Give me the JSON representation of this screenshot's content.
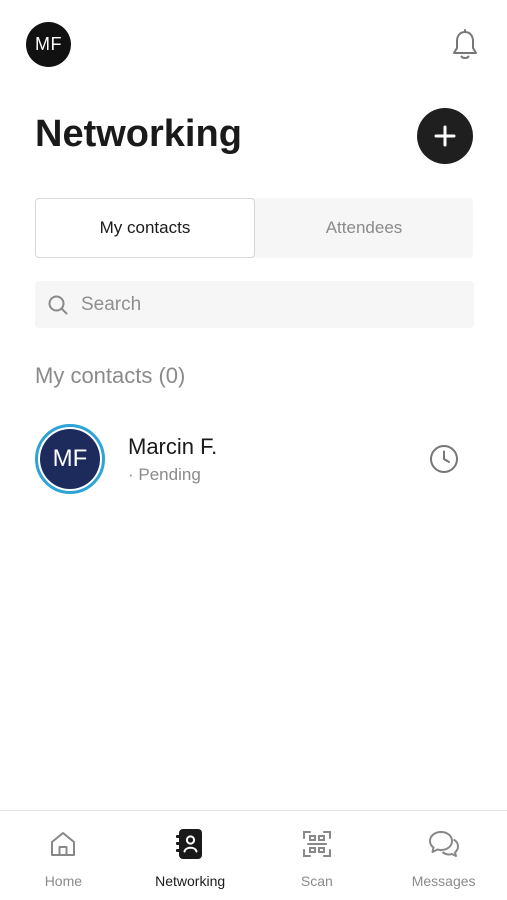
{
  "header": {
    "avatar_initials": "MF",
    "notification_icon": "bell-icon"
  },
  "page": {
    "title": "Networking",
    "add_icon": "plus-icon"
  },
  "tabs": [
    {
      "label": "My contacts",
      "active": true
    },
    {
      "label": "Attendees",
      "active": false
    }
  ],
  "search": {
    "placeholder": "Search",
    "value": "",
    "icon": "search-icon"
  },
  "section": {
    "label": "My contacts (0)"
  },
  "contacts": [
    {
      "initials": "MF",
      "name": "Marcin F.",
      "status": "· Pending",
      "status_icon": "clock-icon"
    }
  ],
  "bottom_nav": [
    {
      "label": "Home",
      "icon": "home-icon",
      "active": false
    },
    {
      "label": "Networking",
      "icon": "contacts-book-icon",
      "active": true
    },
    {
      "label": "Scan",
      "icon": "qr-scan-icon",
      "active": false
    },
    {
      "label": "Messages",
      "icon": "chat-bubbles-icon",
      "active": false
    }
  ],
  "colors": {
    "primary_dark": "#1f1f1f",
    "avatar_ring": "#2ea3d6",
    "avatar_fill": "#1c2b5c",
    "muted_text": "#8a8a8a"
  }
}
